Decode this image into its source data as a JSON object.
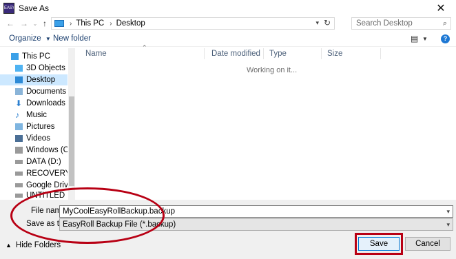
{
  "window": {
    "title": "Save As",
    "app_icon_text": "EASY"
  },
  "address": {
    "crumbs": [
      "This PC",
      "Desktop"
    ]
  },
  "search": {
    "placeholder": "Search Desktop"
  },
  "toolbar": {
    "organize": "Organize",
    "new_folder": "New folder"
  },
  "nav_pane": {
    "items": [
      {
        "label": "This PC",
        "icon": "pc-icon"
      },
      {
        "label": "3D Objects",
        "icon": "cube-icon"
      },
      {
        "label": "Desktop",
        "icon": "desktop-icon",
        "selected": true
      },
      {
        "label": "Documents",
        "icon": "documents-icon"
      },
      {
        "label": "Downloads",
        "icon": "download-icon"
      },
      {
        "label": "Music",
        "icon": "music-icon"
      },
      {
        "label": "Pictures",
        "icon": "pictures-icon"
      },
      {
        "label": "Videos",
        "icon": "videos-icon"
      },
      {
        "label": "Windows (C:)",
        "icon": "drive-icon"
      },
      {
        "label": "DATA (D:)",
        "icon": "drive-icon"
      },
      {
        "label": "RECOVERY (E:)",
        "icon": "drive-icon"
      },
      {
        "label": "Google Drive File",
        "icon": "drive-icon"
      },
      {
        "label": "UNTITLED (I:)",
        "icon": "drive-icon"
      }
    ]
  },
  "columns": {
    "name": "Name",
    "date_modified": "Date modified",
    "type": "Type",
    "size": "Size"
  },
  "status": {
    "working": "Working on it..."
  },
  "form": {
    "file_name_label": "File name:",
    "file_name_value": "MyCoolEasyRollBackup.backup",
    "save_type_label": "Save as type:",
    "save_type_value": "EasyRoll Backup File  (*.backup)"
  },
  "footer": {
    "hide_folders": "Hide Folders",
    "save": "Save",
    "cancel": "Cancel"
  },
  "colors": {
    "annotation": "#b80014",
    "selection": "#cce8ff",
    "accent": "#0078d7"
  }
}
